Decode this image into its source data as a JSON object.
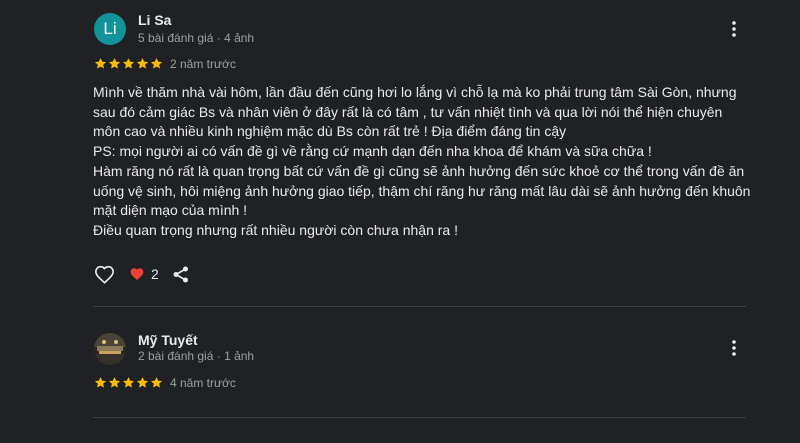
{
  "reviews": [
    {
      "avatar_letter": "Li",
      "avatar_color": "#12939a",
      "name": "Li Sa",
      "meta": "5 bài đánh giá · 4 ảnh",
      "rating": 5,
      "time": "2 năm trước",
      "lines": [
        "Mình về thăm nhà vài hôm, lần đầu đến cũng hơi lo lắng vì chỗ lạ mà ko phải trung tâm Sài Gòn, nhưng",
        "sau đó cảm giác Bs và nhân viên ở đây rất là có tâm , tư vấn nhiệt tình và qua lời nói thể hiện chuyên",
        "môn cao và nhiều kinh nghiệm mặc dù Bs còn rất trẻ ! Địa điểm đáng tin cậy",
        "PS: mọi người ai có vấn đề gì về rằng cứ mạnh dạn đến nha khoa để khám và sữa chữa !",
        "Hàm răng nó rất là quan trọng bất cứ vấn đề gì cũng sẽ ảnh hưởng đến sức khoẻ cơ thể trong vấn đề ăn",
        "uống vệ sinh, hôi miệng ảnh hưởng giao tiếp, thậm chí răng hư răng mất lâu dài sẽ ảnh hưởng đến khuôn",
        "mặt diện mạo của mình !",
        "Điều quan trọng nhưng rất nhiều người còn chưa nhận ra !"
      ],
      "like_count": "2"
    },
    {
      "name": "Mỹ Tuyết",
      "meta": "2 bài đánh giá · 1 ảnh",
      "rating": 5,
      "time": "4 năm trước"
    }
  ],
  "colors": {
    "star": "#fbbc04",
    "heart_filled": "#ea4335",
    "icon": "#e8eaed"
  },
  "icons": [
    "more-vert-icon",
    "star-icon",
    "heart-outline-icon",
    "heart-filled-icon",
    "share-icon"
  ]
}
